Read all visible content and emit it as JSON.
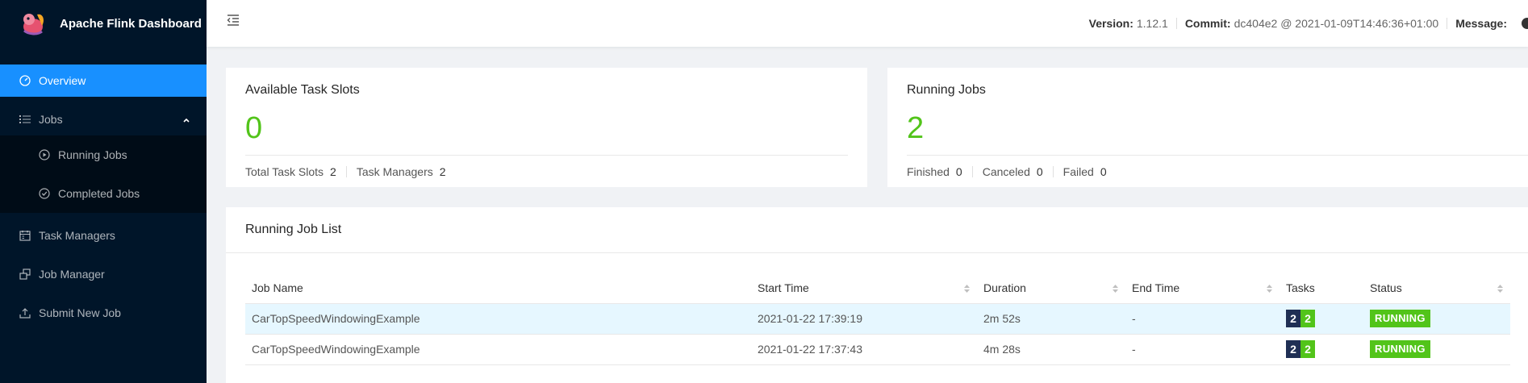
{
  "app": {
    "title": "Apache Flink Dashboard"
  },
  "sidebar": {
    "overview": "Overview",
    "jobs": "Jobs",
    "running_jobs": "Running Jobs",
    "completed_jobs": "Completed Jobs",
    "task_managers": "Task Managers",
    "job_manager": "Job Manager",
    "submit_new_job": "Submit New Job"
  },
  "header": {
    "version_label": "Version:",
    "version_value": "1.12.1",
    "commit_label": "Commit:",
    "commit_value": "dc404e2 @ 2021-01-09T14:46:36+01:00",
    "message_label": "Message:"
  },
  "slots_card": {
    "title": "Available Task Slots",
    "value": "0",
    "total_label": "Total Task Slots",
    "total_value": "2",
    "tm_label": "Task Managers",
    "tm_value": "2"
  },
  "jobs_card": {
    "title": "Running Jobs",
    "value": "2",
    "finished_label": "Finished",
    "finished_value": "0",
    "canceled_label": "Canceled",
    "canceled_value": "0",
    "failed_label": "Failed",
    "failed_value": "0"
  },
  "job_list": {
    "title": "Running Job List",
    "columns": [
      "Job Name",
      "Start Time",
      "Duration",
      "End Time",
      "Tasks",
      "Status"
    ],
    "rows": [
      {
        "name": "CarTopSpeedWindowingExample",
        "start": "2021-01-22 17:39:19",
        "duration": "2m 52s",
        "end": "-",
        "tasks_a": "2",
        "tasks_b": "2",
        "status": "RUNNING"
      },
      {
        "name": "CarTopSpeedWindowingExample",
        "start": "2021-01-22 17:37:43",
        "duration": "4m 28s",
        "end": "-",
        "tasks_a": "2",
        "tasks_b": "2",
        "status": "RUNNING"
      }
    ]
  },
  "colors": {
    "sidebar_bg": "#001529",
    "accent": "#1890ff",
    "success": "#52c41a",
    "task_dark": "#1f2f54"
  }
}
